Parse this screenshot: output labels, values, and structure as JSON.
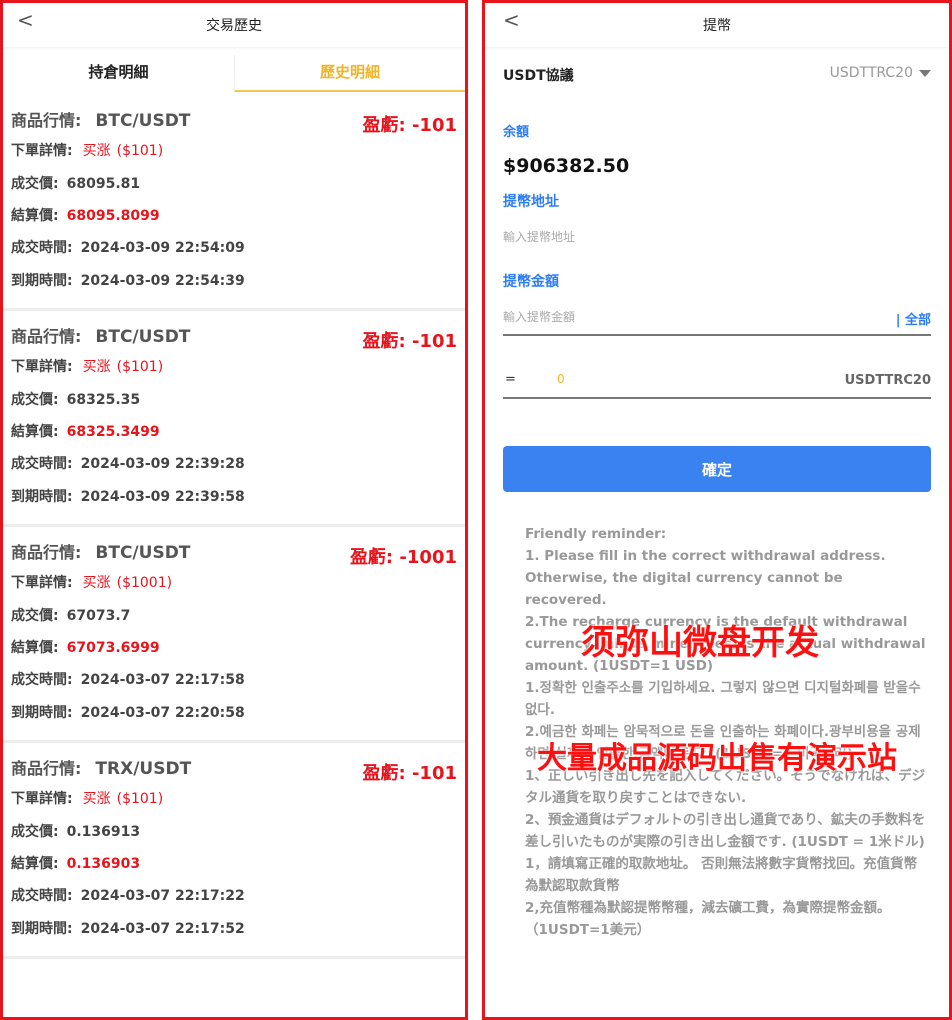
{
  "left": {
    "title": "交易歷史",
    "back_glyph": "<",
    "tabs": [
      "持倉明細",
      "歷史明細"
    ],
    "labels": {
      "product": "商品行情:",
      "order_detail": "下單詳情:",
      "deal_price": "成交價:",
      "settle_price": "結算價:",
      "deal_time": "成交時間:",
      "expire_time": "到期時間:",
      "pnl": "盈虧:"
    },
    "orders": [
      {
        "symbol": "BTC/USDT",
        "direction": "买涨",
        "amount": "($101)",
        "deal_price": "68095.81",
        "settle_price": "68095.8099",
        "deal_time": "2024-03-09 22:54:09",
        "expire_time": "2024-03-09 22:54:39",
        "pnl": "-101"
      },
      {
        "symbol": "BTC/USDT",
        "direction": "买涨",
        "amount": "($101)",
        "deal_price": "68325.35",
        "settle_price": "68325.3499",
        "deal_time": "2024-03-09 22:39:28",
        "expire_time": "2024-03-09 22:39:58",
        "pnl": "-101"
      },
      {
        "symbol": "BTC/USDT",
        "direction": "买涨",
        "amount": "($1001)",
        "deal_price": "67073.7",
        "settle_price": "67073.6999",
        "deal_time": "2024-03-07 22:17:58",
        "expire_time": "2024-03-07 22:20:58",
        "pnl": "-1001"
      },
      {
        "symbol": "TRX/USDT",
        "direction": "买涨",
        "amount": "($101)",
        "deal_price": "0.136913",
        "settle_price": "0.136903",
        "deal_time": "2024-03-07 22:17:22",
        "expire_time": "2024-03-07 22:17:52",
        "pnl": "-101"
      }
    ]
  },
  "right": {
    "title": "提幣",
    "back_glyph": "<",
    "protocol_label": "USDT協議",
    "protocol_value": "USDTTRC20",
    "balance_label": "余額",
    "balance_value": "$906382.50",
    "address_label": "提幣地址",
    "address_placeholder": "輸入提幣地址",
    "amount_label": "提幣金額",
    "amount_placeholder": "輸入提幣金額",
    "all_label": "| 全部",
    "equals_label": "=",
    "equals_value": "0",
    "equals_unit": "USDTTRC20",
    "confirm_label": "確定",
    "reminder": [
      "Friendly reminder:",
      "1. Please fill in the correct withdrawal address. Otherwise, the digital currency cannot be recovered.",
      "2.The recharge currency is the default withdrawal currency, minus miner fees, is the actual withdrawal amount. (1USDT=1 USD)",
      "1.정확한 인출주소를 기입하세요. 그렇지 않으면 디지털화폐를 받을수 없다.",
      "2.예금한 화페는 암묵적으로 돈을 인출하는 화폐이다.광부비용을 공제하면 실제로 인출한 금액이 된다. (1USDT=1 미국달러)",
      "1、正しい引き出し先を記入してください。そうでなければ、デジタル通貨を取り戻すことはできない.",
      "2、預金通貨はデフォルトの引き出し通貨であり、鉱夫の手数料を差し引いたものが実際の引き出し金額です. (1USDT = 1米ドル)",
      "1，請填寫正確的取款地址。 否則無法將數字貨幣找回。充值貨幣為默認取款貨幣",
      "2,充值幣種為默認提幣幣種，減去礦工費，為實際提幣金額。（1USDT=1美元）"
    ],
    "watermark_1": "须弥山微盘开发",
    "watermark_2": "大量成品源码出售有演示站"
  }
}
